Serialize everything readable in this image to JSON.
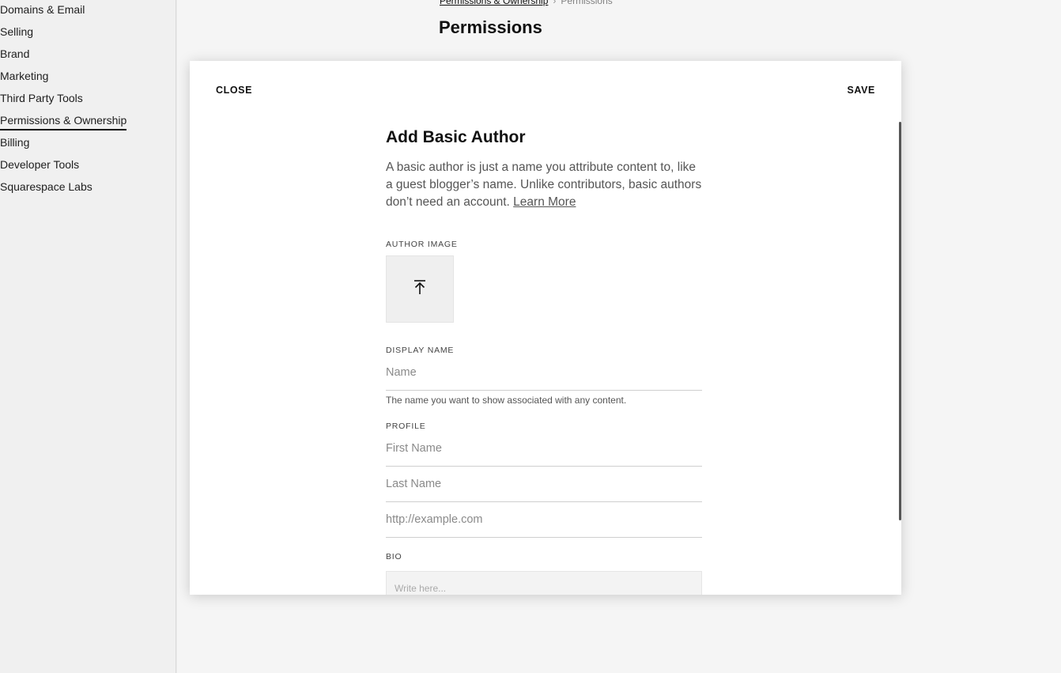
{
  "sidebar": {
    "items": [
      {
        "label": "Domains & Email"
      },
      {
        "label": "Selling"
      },
      {
        "label": "Brand"
      },
      {
        "label": "Marketing"
      },
      {
        "label": "Third Party Tools"
      },
      {
        "label": "Permissions & Ownership"
      },
      {
        "label": "Billing"
      },
      {
        "label": "Developer Tools"
      },
      {
        "label": "Squarespace Labs"
      }
    ],
    "active_index": 5
  },
  "breadcrumb": {
    "parent": "Permissions & Ownership",
    "current": "Permissions"
  },
  "page": {
    "title": "Permissions"
  },
  "modal": {
    "close_label": "CLOSE",
    "save_label": "SAVE",
    "title": "Add Basic Author",
    "description": "A basic author is just a name you attribute content to, like a guest blogger’s name. Unlike contributors, basic authors don’t need an account.",
    "learn_more": "Learn More",
    "author_image_label": "AUTHOR IMAGE",
    "upload_icon": "upload-icon",
    "display_name": {
      "label": "DISPLAY NAME",
      "placeholder": "Name",
      "value": "",
      "help": "The name you want to show associated with any content."
    },
    "profile": {
      "label": "PROFILE",
      "first_name_placeholder": "First Name",
      "last_name_placeholder": "Last Name",
      "website_placeholder": "http://example.com"
    },
    "bio": {
      "label": "BIO",
      "placeholder": "Write here..."
    }
  }
}
